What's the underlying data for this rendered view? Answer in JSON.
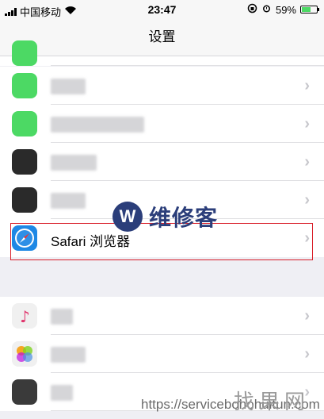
{
  "status_bar": {
    "carrier": "中国移动",
    "time": "23:47",
    "battery_percent": "59%",
    "battery_level": 0.59,
    "icons": [
      "signal-icon",
      "wifi-icon",
      "orientation-lock-icon",
      "alarm-icon",
      "battery-icon"
    ]
  },
  "nav": {
    "title": "设置"
  },
  "rows": [
    {
      "icon": "green-app-icon",
      "icon_color": "#4cd964",
      "label": ""
    },
    {
      "icon": "facetime-icon",
      "icon_color": "#4cd964",
      "label": ""
    },
    {
      "icon": "dark-app-icon",
      "icon_color": "#2a2a2a",
      "label": ""
    },
    {
      "icon": "dark-app-icon-2",
      "icon_color": "#2a2a2a",
      "label": ""
    },
    {
      "icon": "safari-icon",
      "icon_color": "#1e88e5",
      "label": "Safari 浏览器"
    }
  ],
  "rows2": [
    {
      "icon": "music-icon",
      "icon_color": "#f0f0f0",
      "label": ""
    },
    {
      "icon": "photos-icon",
      "icon_color": "#f0f0f0",
      "label": ""
    },
    {
      "icon": "camera-icon",
      "icon_color": "#3a3a3a",
      "label": ""
    }
  ],
  "watermark": {
    "logo_letter": "W",
    "text": "维修客"
  },
  "url_watermark": "https://servicebohohuitun.com",
  "brand_watermark": "找果网",
  "colors": {
    "highlight_border": "#d81e28",
    "chevron": "#c7c7cc",
    "watermark": "#2b3e7a"
  }
}
